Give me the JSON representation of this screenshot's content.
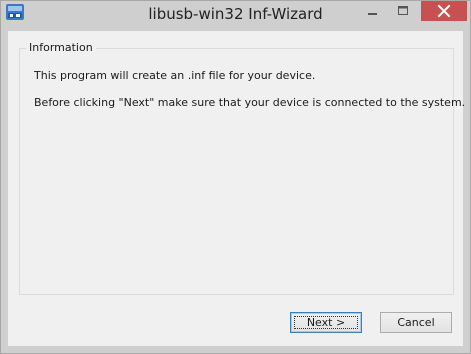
{
  "window": {
    "title": "libusb-win32 Inf-Wizard",
    "icon": "usb-app-icon",
    "close_color": "#c75050"
  },
  "group": {
    "title": "Information",
    "lines": [
      "This program will create an .inf file for your device.",
      "Before clicking \"Next\" make sure that your device is connected to the system."
    ]
  },
  "buttons": {
    "next_label": "Next >",
    "cancel_label": "Cancel"
  }
}
